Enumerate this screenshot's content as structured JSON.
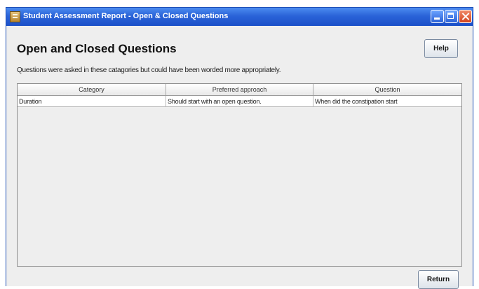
{
  "window": {
    "title": "Student Assessment Report - Open & Closed Questions"
  },
  "header": {
    "title": "Open and Closed Questions",
    "description": "Questions were asked in these catagories but could have been worded more appropriately."
  },
  "buttons": {
    "help": "Help",
    "return": "Return"
  },
  "table": {
    "columns": [
      "Category",
      "Preferred approach",
      "Question"
    ],
    "rows": [
      [
        "Duration",
        "Should start with an open question.",
        "When did the constipation start"
      ]
    ]
  },
  "icons": {
    "app": "report-icon",
    "minimize": "minimize-icon",
    "maximize": "maximize-icon",
    "close": "close-icon"
  },
  "colors": {
    "titlebar": "#2a63d8",
    "window_bg": "#eeeeee",
    "close_button": "#d3441e"
  }
}
